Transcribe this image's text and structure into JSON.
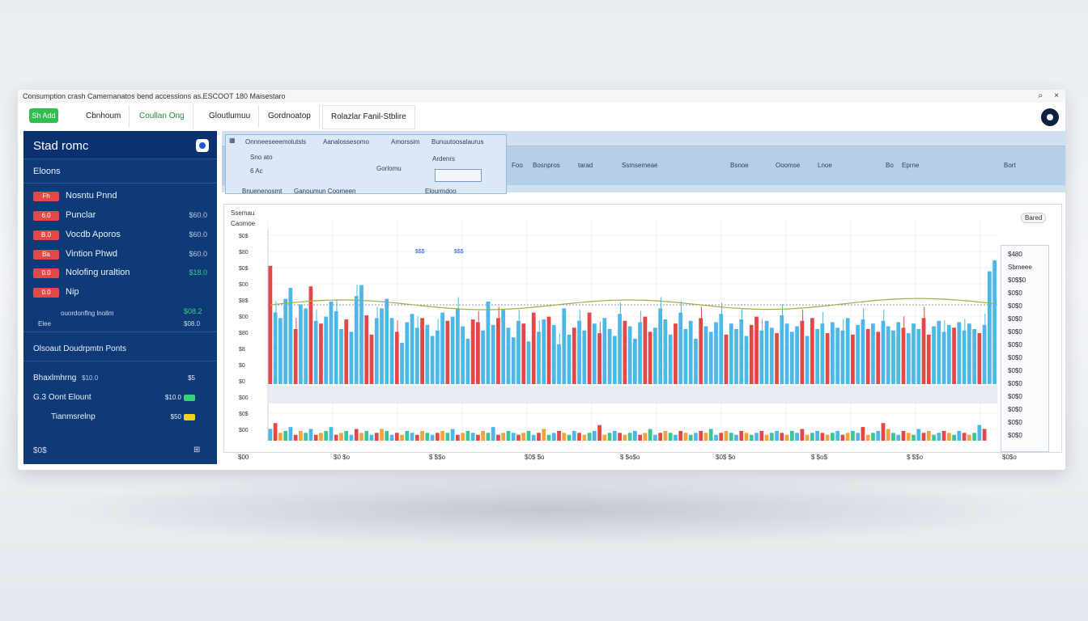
{
  "window": {
    "title": "Consumption crash Camemanatos bend accessions as.ESCOOT 180  Maisestaro",
    "close": "×",
    "pin": "⌕"
  },
  "toolbar": {
    "brand": "Sh Add",
    "tabs": [
      {
        "label": "Cbnhoum"
      },
      {
        "label": "Coullan Ong"
      },
      {
        "label": "Gloutlumuu"
      },
      {
        "label": "Gordnoatop"
      },
      {
        "label": "Rolazlar Fanil-Stblire"
      }
    ]
  },
  "sidebar": {
    "title": "Stad romc",
    "subtitle": "Eloons",
    "items": [
      {
        "badge": "Fh",
        "label": "Nosntu Pnnd",
        "value": ""
      },
      {
        "badge": "6.0",
        "label": "Punclar",
        "value": "$60.0"
      },
      {
        "badge": "B.0",
        "label": "Vocdb Aporos",
        "value": "$60.0"
      },
      {
        "badge": "Ba",
        "label": "Vintion Phwd",
        "value": "$60.0"
      },
      {
        "badge": "0.0",
        "label": "Nolofing uraltion",
        "value": "$18.0"
      },
      {
        "badge": "0.0",
        "label": "Nip",
        "value": ""
      }
    ],
    "subtotal_label": "ouordonflng lnoilm",
    "subtotal_value": "$08.2",
    "subtotal_note": "Elee",
    "subtotal_note_value": "$08.0",
    "section_title": "Olsoaut Doudrpmtn Ponts",
    "rows": [
      {
        "label": "Bhaxlmhrng",
        "sub": "$10.0",
        "value": "$5"
      },
      {
        "label": "G.3 Oont Elount",
        "sub": "",
        "value": "$10.0"
      },
      {
        "label": "Tianmsrelnp",
        "sub": "",
        "value": "$50"
      }
    ],
    "footer_left": "$0$",
    "footer_right": "⊞",
    "colors": {
      "bg": "#0f3a78",
      "badge": "#e24848",
      "positive": "#39d17a",
      "warn": "#f2d21b"
    }
  },
  "topstrip": {
    "left_labels": [
      "Onnneeseeemolutsls",
      "Aanalossesomo",
      "Amorssim",
      "Bunuutoosalaurus"
    ],
    "row2": [
      "Sno ato",
      "6  Ac",
      "Gorlomu",
      "Ardenrs"
    ],
    "row3": [
      "Bnuenenosmt",
      "Ganoumun Coomeen",
      "Elourmdoo"
    ],
    "headers": [
      "Foo",
      "Bosnpros",
      "tarad",
      "Ssmsemeae",
      "Bsnoe",
      "Ooomse",
      "Lnoe",
      "Bo",
      "Eprne",
      "Bort"
    ]
  },
  "chart_data": {
    "type": "bar",
    "title": "Ssemau",
    "subtitle": "Caomoe",
    "y_ticks": [
      "$0$",
      "$80",
      "$0$",
      "$00",
      "$8$",
      "$00",
      "$80",
      "$8",
      "$0",
      "$0",
      "$00",
      "$0$",
      "$00"
    ],
    "x_ticks": [
      "$00",
      "$0 $o",
      "$ $$o",
      "$0$ $o",
      "$ $o$o",
      "$0$ $o",
      "$ $o$",
      "$ $$o",
      "$0$o"
    ],
    "right_values": [
      "$480",
      "Sbmeee",
      "$0$$0",
      "$0$0",
      "$0$0",
      "$0$0",
      "$0$0",
      "$0$0",
      "$0$0",
      "$0$0",
      "$0$0",
      "$0$0",
      "$0$0",
      "$0$0",
      "$0$0"
    ],
    "legend_tags": [
      "$$$",
      "$$$"
    ],
    "top_right": "Bared",
    "series": [
      {
        "name": "up",
        "color": "#4db8e8"
      },
      {
        "name": "down",
        "color": "#e24848"
      },
      {
        "name": "trend",
        "color": "#9cb04a"
      }
    ],
    "main_values": [
      0.86,
      0.52,
      0.48,
      0.62,
      0.7,
      0.4,
      0.58,
      0.55,
      0.71,
      0.46,
      0.44,
      0.49,
      0.6,
      0.53,
      0.4,
      0.47,
      0.38,
      0.64,
      0.72,
      0.5,
      0.36,
      0.48,
      0.55,
      0.62,
      0.48,
      0.38,
      0.3,
      0.45,
      0.51,
      0.41,
      0.48,
      0.43,
      0.35,
      0.39,
      0.52,
      0.46,
      0.49,
      0.55,
      0.42,
      0.33,
      0.47,
      0.45,
      0.39,
      0.6,
      0.43,
      0.48,
      0.54,
      0.41,
      0.34,
      0.46,
      0.44,
      0.31,
      0.52,
      0.38,
      0.47,
      0.49,
      0.43,
      0.29,
      0.55,
      0.36,
      0.41,
      0.46,
      0.39,
      0.52,
      0.44,
      0.37,
      0.48,
      0.4,
      0.35,
      0.51,
      0.46,
      0.42,
      0.33,
      0.45,
      0.49,
      0.38,
      0.41,
      0.55,
      0.47,
      0.36,
      0.44,
      0.52,
      0.4,
      0.46,
      0.33,
      0.48,
      0.42,
      0.38,
      0.45,
      0.51,
      0.36,
      0.44,
      0.4,
      0.47,
      0.35,
      0.43,
      0.49,
      0.39,
      0.46,
      0.41,
      0.37,
      0.5,
      0.44,
      0.38,
      0.42,
      0.46,
      0.35,
      0.48,
      0.4,
      0.44,
      0.37,
      0.45,
      0.41,
      0.39,
      0.48,
      0.36,
      0.43,
      0.47,
      0.4,
      0.44,
      0.38,
      0.46,
      0.42,
      0.39,
      0.45,
      0.41,
      0.37,
      0.44,
      0.4,
      0.48,
      0.36,
      0.42,
      0.46,
      0.38,
      0.43,
      0.41,
      0.45,
      0.39,
      0.44,
      0.4,
      0.37,
      0.43,
      0.82,
      0.9
    ],
    "volume_values": [
      0.6,
      0.9,
      0.4,
      0.5,
      0.7,
      0.3,
      0.5,
      0.4,
      0.6,
      0.3,
      0.4,
      0.5,
      0.7,
      0.3,
      0.4,
      0.5,
      0.3,
      0.6,
      0.4,
      0.5,
      0.3,
      0.4,
      0.6,
      0.5,
      0.3,
      0.4,
      0.3,
      0.5,
      0.4,
      0.3,
      0.5,
      0.4,
      0.3,
      0.4,
      0.5,
      0.4,
      0.6,
      0.3,
      0.4,
      0.5,
      0.4,
      0.3,
      0.5,
      0.4,
      0.7,
      0.3,
      0.4,
      0.5,
      0.4,
      0.3,
      0.4,
      0.5,
      0.3,
      0.4,
      0.6,
      0.3,
      0.4,
      0.5,
      0.4,
      0.3,
      0.5,
      0.4,
      0.3,
      0.4,
      0.5,
      0.8,
      0.3,
      0.4,
      0.5,
      0.4,
      0.3,
      0.4,
      0.5,
      0.3,
      0.4,
      0.6,
      0.3,
      0.4,
      0.5,
      0.4,
      0.3,
      0.5,
      0.4,
      0.3,
      0.4,
      0.5,
      0.4,
      0.6,
      0.3,
      0.4,
      0.5,
      0.4,
      0.3,
      0.5,
      0.4,
      0.3,
      0.4,
      0.5,
      0.3,
      0.4,
      0.5,
      0.4,
      0.3,
      0.5,
      0.4,
      0.6,
      0.3,
      0.4,
      0.5,
      0.4,
      0.3,
      0.4,
      0.5,
      0.3,
      0.4,
      0.5,
      0.4,
      0.7,
      0.3,
      0.4,
      0.5,
      0.9,
      0.6,
      0.4,
      0.3,
      0.5,
      0.4,
      0.3,
      0.6,
      0.4,
      0.5,
      0.3,
      0.4,
      0.5,
      0.4,
      0.3,
      0.5,
      0.4,
      0.3,
      0.4,
      0.8,
      0.6
    ]
  }
}
